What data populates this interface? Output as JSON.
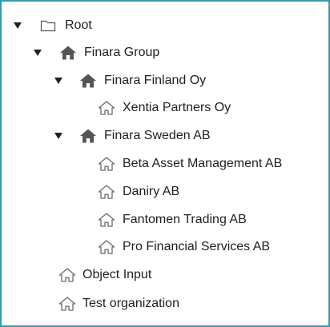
{
  "tree": {
    "root": {
      "label": "Root",
      "expanded": true,
      "icon": "folder-icon"
    },
    "finara_group": {
      "label": "Finara Group",
      "expanded": true,
      "icon": "home-filled-icon"
    },
    "finara_finland": {
      "label": "Finara Finland Oy",
      "expanded": true,
      "icon": "home-filled-icon"
    },
    "xentia": {
      "label": "Xentia Partners Oy",
      "icon": "home-outline-icon"
    },
    "finara_sweden": {
      "label": "Finara Sweden AB",
      "expanded": true,
      "icon": "home-filled-icon"
    },
    "beta": {
      "label": "Beta Asset Management AB",
      "icon": "home-outline-icon"
    },
    "daniry": {
      "label": "Daniry AB",
      "icon": "home-outline-icon"
    },
    "fantomen": {
      "label": "Fantomen Trading AB",
      "icon": "home-outline-icon"
    },
    "pro_financial": {
      "label": "Pro Financial Services AB",
      "icon": "home-outline-icon"
    },
    "object_input": {
      "label": "Object Input",
      "icon": "home-outline-icon"
    },
    "test_org": {
      "label": "Test organization",
      "icon": "home-outline-icon"
    }
  },
  "colors": {
    "border": "#3a9aa5",
    "text": "#1f1f1f",
    "icon_filled": "#555555",
    "icon_outline": "#6b6b6b",
    "toggle": "#222222"
  }
}
